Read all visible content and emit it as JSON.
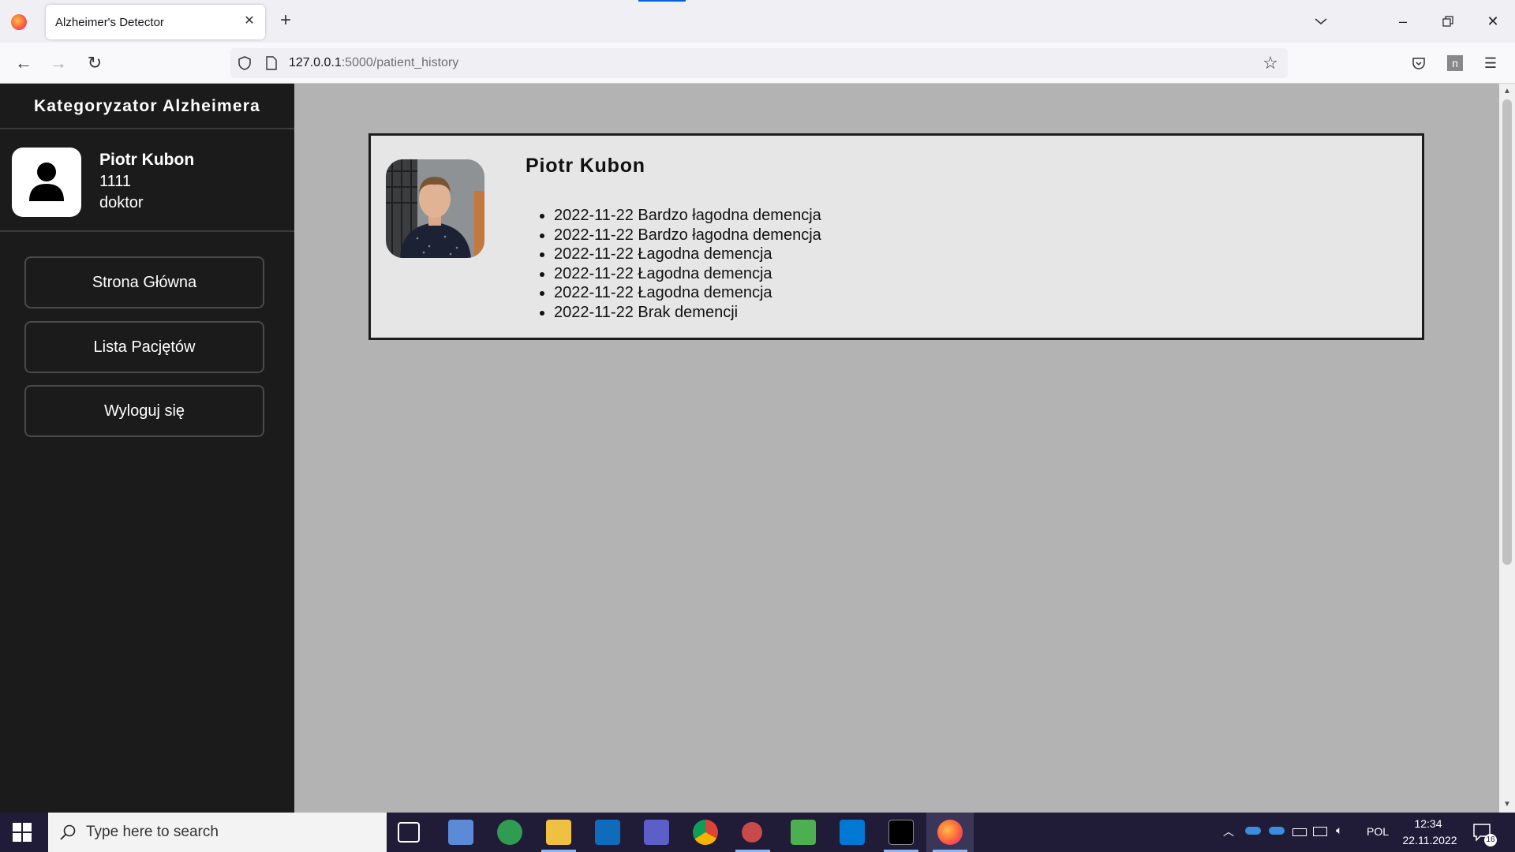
{
  "browser": {
    "tab_title": "Alzheimer's Detector",
    "url_host": "127.0.0.1",
    "url_path": ":5000/patient_history"
  },
  "sidebar": {
    "brand": "Kategoryzator Alzheimera",
    "user": {
      "name": "Piotr Kubon",
      "id": "1111",
      "role": "doktor"
    },
    "menu": [
      {
        "label": "Strona Główna"
      },
      {
        "label": "Lista Pacjętów"
      },
      {
        "label": "Wyloguj się"
      }
    ]
  },
  "patient": {
    "name": "Piotr Kubon",
    "history": [
      "2022-11-22 Bardzo łagodna demencja",
      "2022-11-22 Bardzo łagodna demencja",
      "2022-11-22 Łagodna demencja",
      "2022-11-22 Łagodna demencja",
      "2022-11-22 Łagodna demencja",
      "2022-11-22 Brak demencji"
    ]
  },
  "taskbar": {
    "search_placeholder": "Type here to search",
    "language": "POL",
    "time": "12:34",
    "date": "22.11.2022",
    "notification_count": "16"
  },
  "colors": {
    "sidebar_bg": "#1b1b1b",
    "content_bg": "#b3b3b3",
    "card_bg": "#e6e6e6",
    "taskbar_bg": "#201c38"
  }
}
